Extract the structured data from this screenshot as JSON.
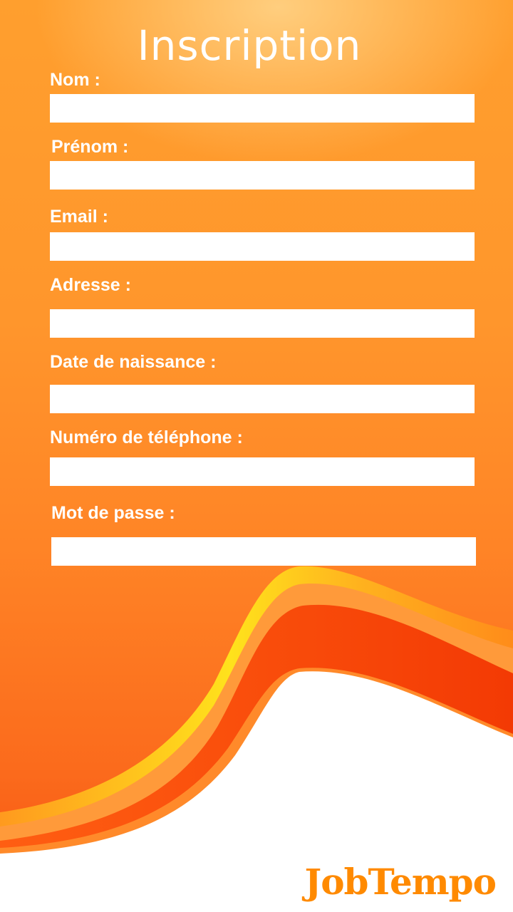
{
  "page": {
    "title": "Inscription",
    "brand": "JobTempo"
  },
  "form": {
    "fields": [
      {
        "label": "Nom :",
        "value": "",
        "placeholder": ""
      },
      {
        "label": "Prénom :",
        "value": "",
        "placeholder": ""
      },
      {
        "label": "Email :",
        "value": "",
        "placeholder": ""
      },
      {
        "label": "Adresse :",
        "value": "",
        "placeholder": ""
      },
      {
        "label": "Date de naissance :",
        "value": "",
        "placeholder": ""
      },
      {
        "label": "Numéro de téléphone :",
        "value": "",
        "placeholder": ""
      },
      {
        "label": "Mot de passe :",
        "value": "",
        "placeholder": ""
      }
    ]
  },
  "colors": {
    "background_orange": "#ff962c",
    "wave_red": "#f53d06",
    "wave_yellow": "#ffd21f",
    "brand": "#ff8a00",
    "field_bg": "#ffffff"
  }
}
